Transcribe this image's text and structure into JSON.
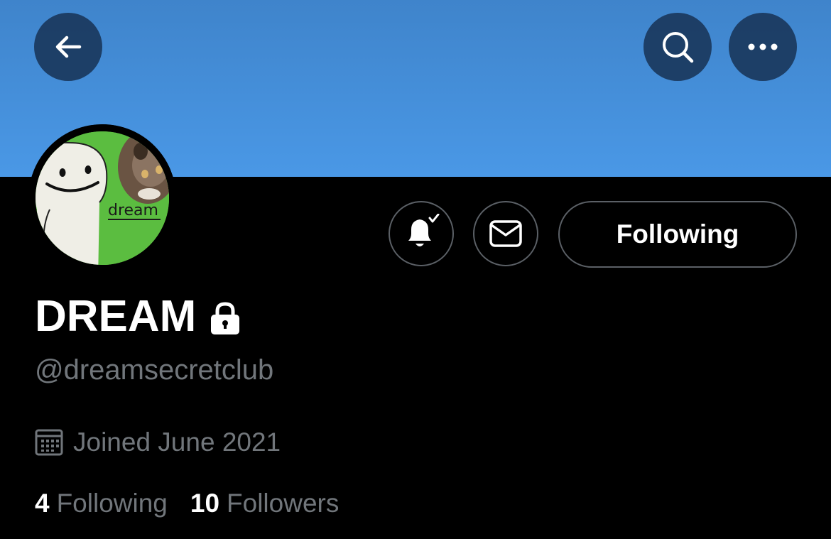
{
  "colors": {
    "banner": "#4a98e6",
    "background": "#000000",
    "muted_text": "#71767b",
    "button_border": "#5b6066",
    "overlay_button": "#183458"
  },
  "header": {
    "back_icon": "arrow-left-icon",
    "search_icon": "search-icon",
    "more_icon": "more-horizontal-icon"
  },
  "profile": {
    "avatar_text": "dream",
    "display_name": "DREAM",
    "protected_icon": "lock-icon",
    "handle": "@dreamsecretclub",
    "joined": "Joined June 2021",
    "joined_icon": "calendar-icon"
  },
  "actions": {
    "notifications_icon": "bell-check-icon",
    "message_icon": "mail-icon",
    "follow_label": "Following"
  },
  "stats": {
    "following_count": "4",
    "following_label": "Following",
    "followers_count": "10",
    "followers_label": "Followers"
  }
}
